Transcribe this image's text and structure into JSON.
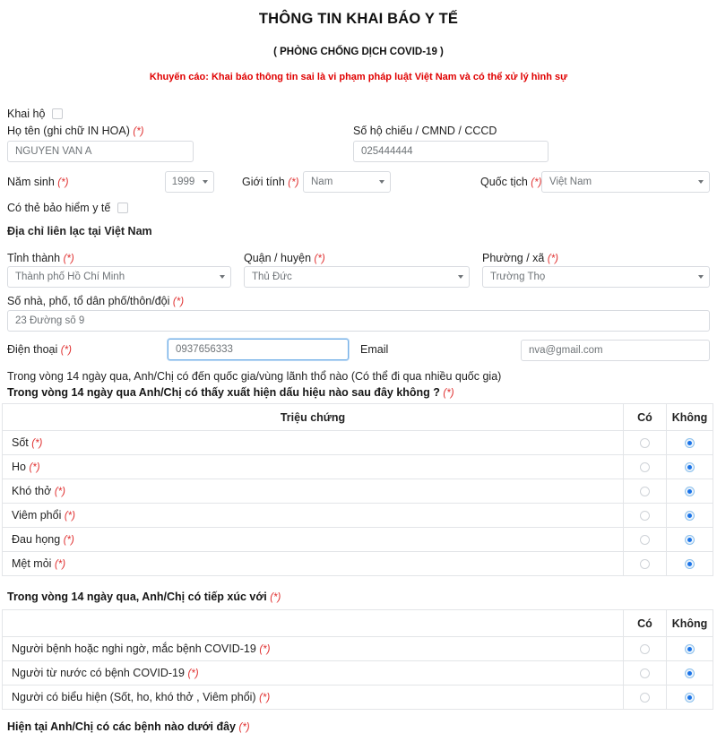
{
  "header": {
    "title": "THÔNG TIN KHAI BÁO Y TẾ",
    "subtitle": "( PHÒNG CHỐNG DỊCH COVID-19 )",
    "warning": "Khuyến cáo: Khai báo thông tin sai là vi phạm pháp luật Việt Nam và có thể xử lý hình sự"
  },
  "form": {
    "declare_for_other_label": "Khai hộ",
    "fullname_label": "Họ tên (ghi chữ IN HOA)",
    "fullname_value": "NGUYEN VAN A",
    "passport_label": "Số hộ chiếu / CMND / CCCD",
    "passport_value": "025444444",
    "birthyear_label": "Năm sinh",
    "birthyear_value": "1999",
    "gender_label": "Giới tính",
    "gender_value": "Nam",
    "nationality_label": "Quốc tịch",
    "nationality_value": "Việt Nam",
    "insurance_label": "Có thẻ bảo hiểm y tế",
    "address_heading": "Địa chỉ liên lạc tại Việt Nam",
    "province_label": "Tỉnh thành",
    "province_value": "Thành phố Hồ Chí Minh",
    "district_label": "Quận / huyện",
    "district_value": "Thủ Đức",
    "ward_label": "Phường / xã",
    "ward_value": "Trường Thọ",
    "street_label": "Số nhà, phố, tổ dân phố/thôn/đội",
    "street_value": "23 Đường số 9",
    "phone_label": "Điện thoại",
    "phone_value": "0937656333",
    "email_label": "Email",
    "email_value": "nva@gmail.com",
    "travel_question": "Trong vòng 14 ngày qua, Anh/Chị có đến quốc gia/vùng lãnh thổ nào (Có thể đi qua nhiều quốc gia)",
    "required_mark": "(*)"
  },
  "symptoms": {
    "question": "Trong vòng 14 ngày qua Anh/Chị có thấy xuất hiện dấu hiệu nào sau đây không ?",
    "columns": [
      "Triệu chứng",
      "Có",
      "Không"
    ],
    "rows": [
      {
        "label": "Sốt",
        "yes": false,
        "no": true
      },
      {
        "label": "Ho",
        "yes": false,
        "no": true
      },
      {
        "label": "Khó thở",
        "yes": false,
        "no": true
      },
      {
        "label": "Viêm phổi",
        "yes": false,
        "no": true
      },
      {
        "label": "Đau họng",
        "yes": false,
        "no": true
      },
      {
        "label": "Mệt mỏi",
        "yes": false,
        "no": true
      }
    ]
  },
  "contacts": {
    "question": "Trong vòng 14 ngày qua, Anh/Chị có tiếp xúc với",
    "columns": [
      "",
      "Có",
      "Không"
    ],
    "rows": [
      {
        "label": "Người bệnh hoặc nghi ngờ, mắc bệnh COVID-19",
        "yes": false,
        "no": true
      },
      {
        "label": "Người từ nước có bệnh COVID-19",
        "yes": false,
        "no": true
      },
      {
        "label": "Người có biểu hiện (Sốt, ho, khó thở , Viêm phổi)",
        "yes": false,
        "no": true
      }
    ]
  },
  "diseases": {
    "question": "Hiện tại Anh/Chị có các bệnh nào dưới đây"
  },
  "colors": {
    "required": "#e03131",
    "warning": "#e00000",
    "radio_selected": "#1a73e8",
    "focus_border": "#74b0e8",
    "border": "#d8dbe0"
  }
}
